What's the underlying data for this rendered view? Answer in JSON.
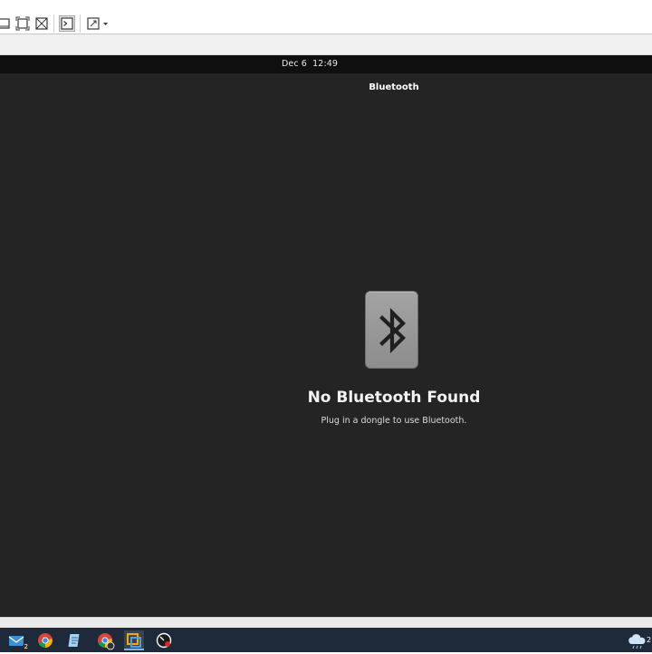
{
  "host": {
    "toolbar_icons": [
      "window-icon",
      "fit-window-icon",
      "stretch-icon",
      "console-icon",
      "fullscreen-icon"
    ]
  },
  "guest": {
    "top_bar": {
      "date": "Dec 6",
      "time": "12:49"
    },
    "window_title": "Bluetooth",
    "empty_state": {
      "icon": "bluetooth-icon",
      "title": "No Bluetooth Found",
      "subtitle": "Plug in a dongle to use Bluetooth."
    }
  },
  "taskbar": {
    "items": [
      {
        "icon": "mail-icon",
        "badge": "2"
      },
      {
        "icon": "chrome-icon"
      },
      {
        "icon": "notepad-icon"
      },
      {
        "icon": "chrome-profile-icon"
      },
      {
        "icon": "vmware-icon",
        "active": true
      },
      {
        "icon": "speedometer-icon"
      }
    ],
    "tray_text": "2"
  },
  "colors": {
    "guest_bg": "#242424",
    "top_bar_bg": "#0f0f0f",
    "tile": "#9a9a9a",
    "taskbar_bg": "#1e2a3a"
  }
}
